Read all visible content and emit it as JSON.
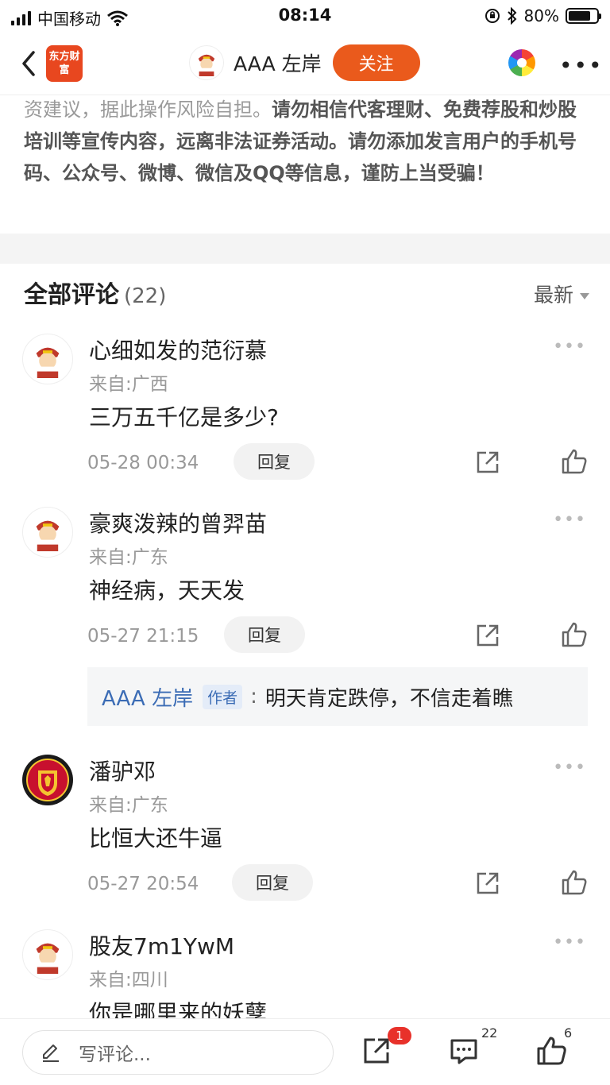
{
  "status_bar": {
    "carrier": "中国移动",
    "time": "08:14",
    "battery": "80%",
    "battery_level": 0.8
  },
  "nav": {
    "logo_text": "东方财富",
    "user_name": "AAA 左岸",
    "follow_label": "关注"
  },
  "disclaimer": {
    "gray_text": "资建议，据此操作风险自担。",
    "bold_text": "请勿相信代客理财、免费荐股和炒股培训等宣传内容，远离非法证券活动。请勿添加发言用户的手机号码、公众号、微博、微信及QQ等信息，谨防上当受骗！"
  },
  "comments_header": {
    "title": "全部评论",
    "count": "(22)",
    "sort_label": "最新"
  },
  "comments": [
    {
      "user": "心细如发的范衍慕",
      "from": "来自:广西",
      "text": "三万五千亿是多少?",
      "time": "05-28 00:34",
      "reply_label": "回复",
      "avatar": "caishen-avatar"
    },
    {
      "user": "豪爽泼辣的曾羿苗",
      "from": "来自:广东",
      "text": "神经病，天天发",
      "time": "05-27 21:15",
      "reply_label": "回复",
      "avatar": "caishen-avatar"
    },
    {
      "user": "潘驴邓",
      "from": "来自:广东",
      "text": "比恒大还牛逼",
      "time": "05-27 20:54",
      "reply_label": "回复",
      "avatar": "manchester-united-crest"
    },
    {
      "user": "股友7m1YwM",
      "from": "来自:四川",
      "text": "你是哪里来的妖孽",
      "time": "",
      "reply_label": "",
      "avatar": "caishen-avatar"
    }
  ],
  "author_reply": {
    "author": "AAA 左岸",
    "tag": "作者",
    "colon": ":",
    "text": "明天肯定跌停，不信走着瞧"
  },
  "bottom_bar": {
    "input_placeholder": "写评论...",
    "share_badge": "1",
    "comment_count": "22",
    "like_count": "6"
  },
  "colors": {
    "brand": "#ea5a1c",
    "author_blue": "#3b6cb5",
    "badge_red": "#e8312a"
  }
}
